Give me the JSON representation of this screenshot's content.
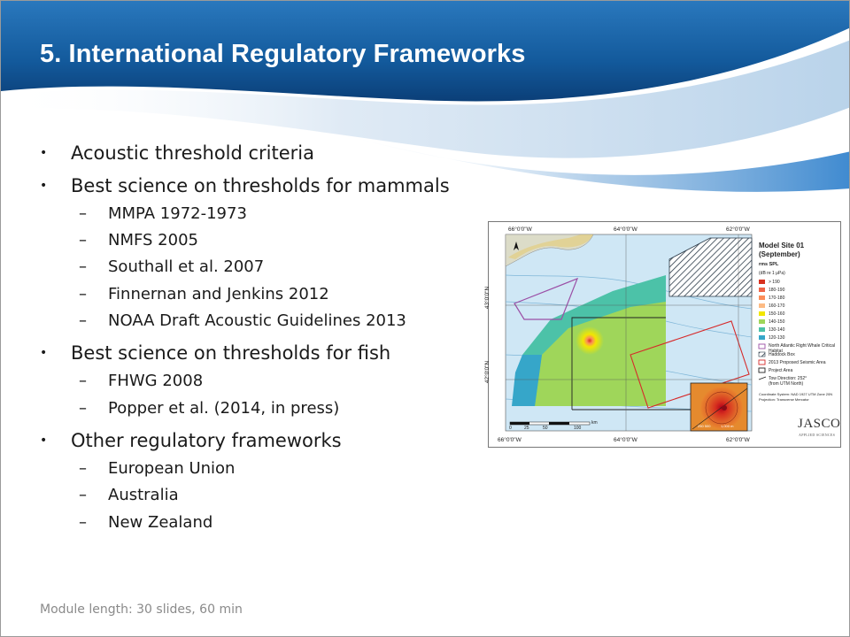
{
  "slide": {
    "title": "5. International Regulatory Frameworks",
    "footer": "Module length: 30 slides, 60 min",
    "bullet_symbol": "•",
    "sub_symbol": "–"
  },
  "bullets": [
    {
      "text": "Acoustic threshold criteria",
      "subs": []
    },
    {
      "text": "Best science on thresholds for mammals",
      "subs": [
        "MMPA 1972-1973",
        "NMFS 2005",
        "Southall et al. 2007",
        "Finnernan and Jenkins 2012",
        "NOAA Draft Acoustic Guidelines 2013"
      ]
    },
    {
      "text": "Best science on thresholds for fish",
      "subs": [
        "FHWG 2008",
        "Popper et al. (2014, in press)"
      ]
    },
    {
      "text": "Other regulatory frameworks",
      "subs": [
        "European Union",
        "Australia",
        "New Zealand"
      ]
    }
  ],
  "map": {
    "title_line1": "Model Site 01",
    "title_line2": "(September)",
    "metric": "rms SPL",
    "unit": "(dB re 1 μPa)",
    "lon_labels_top": [
      "66°0'0\"W",
      "64°0'0\"W",
      "62°0'0\"W"
    ],
    "lon_labels_bottom": [
      "66°0'0\"W",
      "64°0'0\"W",
      "62°0'0\"W"
    ],
    "lat_labels": [
      "43°0'0\"N",
      "42°0'0\"N"
    ],
    "scale_unit": "km",
    "scale_ticks": [
      "0",
      "25",
      "50",
      "100"
    ],
    "inset_scale": [
      "250 500",
      "1,000 m"
    ],
    "levels": [
      {
        "label": "> 190",
        "color": "#d7301f"
      },
      {
        "label": "180-190",
        "color": "#ef6548"
      },
      {
        "label": "170-180",
        "color": "#fc8d59"
      },
      {
        "label": "160-170",
        "color": "#fdbb84"
      },
      {
        "label": "150-160",
        "color": "#f2e600"
      },
      {
        "label": "140-150",
        "color": "#9fd65a"
      },
      {
        "label": "130-140",
        "color": "#4cc2a8"
      },
      {
        "label": "120-130",
        "color": "#36a6c9"
      }
    ],
    "features": [
      {
        "label": "North Atlantic Right Whale Critical Habitat"
      },
      {
        "label": "Haddock Box"
      },
      {
        "label": "2013 Proposed Seismic Area"
      },
      {
        "label": "Project Area"
      }
    ],
    "tow_label": "Tow Direction: 252°",
    "tow_sub": "(from UTM North)",
    "coord_system": "Coordinate System: NAD 1927 UTM Zone 20N",
    "projection": "Projection: Transverse Mercator",
    "logo_text": "JASCO",
    "logo_sub": "APPLIED SCIENCES"
  }
}
